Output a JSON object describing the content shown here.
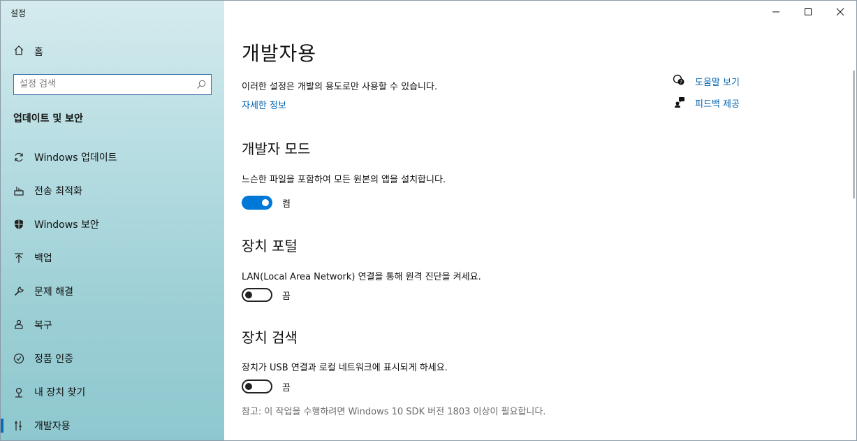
{
  "window": {
    "title": "설정"
  },
  "sidebar": {
    "home_label": "홈",
    "search_placeholder": "설정 검색",
    "section_header": "업데이트 및 보안",
    "items": [
      {
        "label": "Windows 업데이트",
        "icon": "refresh-icon"
      },
      {
        "label": "전송 최적화",
        "icon": "delivery-optimization-icon"
      },
      {
        "label": "Windows 보안",
        "icon": "shield-icon"
      },
      {
        "label": "백업",
        "icon": "backup-arrow-icon"
      },
      {
        "label": "문제 해결",
        "icon": "wrench-icon"
      },
      {
        "label": "복구",
        "icon": "recovery-icon"
      },
      {
        "label": "정품 인증",
        "icon": "check-circle-icon"
      },
      {
        "label": "내 장치 찾기",
        "icon": "find-device-icon"
      },
      {
        "label": "개발자용",
        "icon": "developer-icon",
        "active": true
      }
    ]
  },
  "main": {
    "title": "개발자용",
    "description": "이러한 설정은 개발의 용도로만 사용할 수 있습니다.",
    "learn_more": "자세한 정보",
    "dev_mode": {
      "title": "개발자 모드",
      "description": "느슨한 파일을 포함하여 모든 원본의 앱을 설치합니다.",
      "state_label": "켬",
      "on": true
    },
    "device_portal": {
      "title": "장치 포털",
      "description": "LAN(Local Area Network) 연결을 통해 원격 진단을 켜세요.",
      "state_label": "끔",
      "on": false
    },
    "device_discovery": {
      "title": "장치 검색",
      "description": "장치가 USB 연결과 로컬 네트워크에 표시되게 하세요.",
      "state_label": "끔",
      "on": false,
      "note": "참고: 이 작업을 수행하려면 Windows 10 SDK 버전 1803 이상이 필요합니다."
    }
  },
  "side_links": {
    "help": "도움말 보기",
    "feedback": "피드백 제공"
  },
  "colors": {
    "accent": "#0078d7",
    "link": "#0063b1"
  }
}
